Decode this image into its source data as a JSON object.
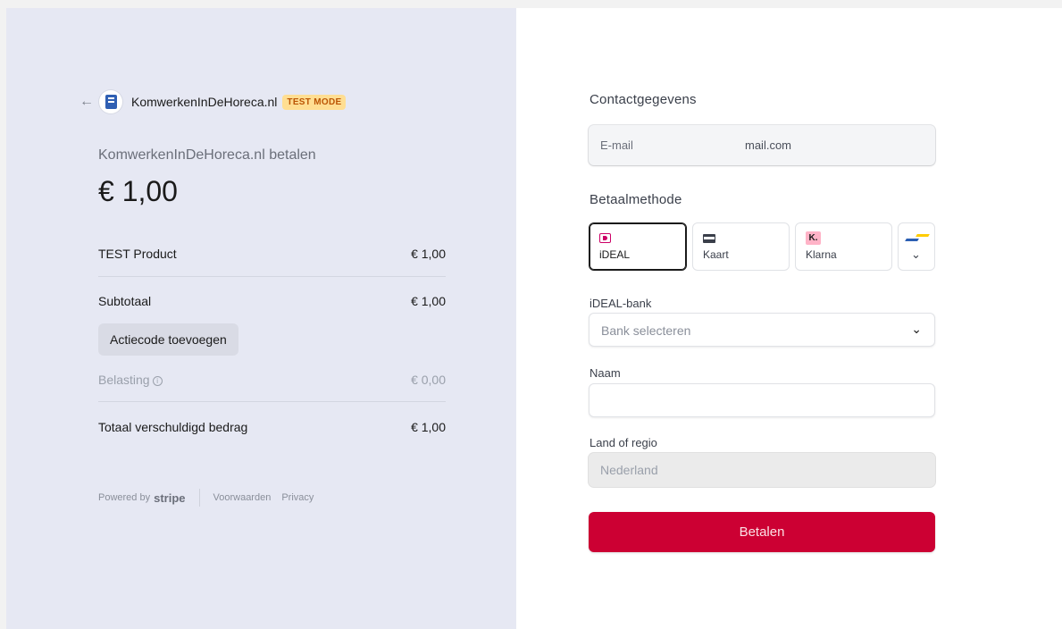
{
  "summary": {
    "back_icon": "arrow-left-icon",
    "merchant_name": "KomwerkenInDeHoreca.nl",
    "test_mode_badge": "TEST MODE",
    "pay_label": "KomwerkenInDeHoreca.nl betalen",
    "amount": "€ 1,00",
    "line_items": [
      {
        "name": "TEST Product",
        "price": "€ 1,00"
      }
    ],
    "subtotal_label": "Subtotaal",
    "subtotal_value": "€ 1,00",
    "promo_button": "Actiecode toevoegen",
    "tax_label": "Belasting",
    "tax_icon": "info-icon",
    "tax_value": "€ 0,00",
    "total_label": "Totaal verschuldigd bedrag",
    "total_value": "€ 1,00"
  },
  "footer": {
    "powered_by": "Powered by",
    "brand": "stripe",
    "terms": "Voorwaarden",
    "privacy": "Privacy"
  },
  "form": {
    "contact_title": "Contactgegevens",
    "email_label": "E-mail",
    "email_value": "mail.com",
    "payment_title": "Betaalmethode",
    "methods": [
      {
        "label": "iDEAL",
        "icon": "ideal-icon",
        "selected": true
      },
      {
        "label": "Kaart",
        "icon": "card-icon",
        "selected": false
      },
      {
        "label": "Klarna",
        "icon": "klarna-icon",
        "icon_text": "K.",
        "selected": false
      }
    ],
    "more_methods_icon": "chevron-down-icon",
    "bank_label": "iDEAL-bank",
    "bank_placeholder": "Bank selecteren",
    "name_label": "Naam",
    "name_value": "",
    "country_label": "Land of regio",
    "country_value": "Nederland",
    "pay_button": "Betalen"
  },
  "colors": {
    "accent": "#cc0033",
    "left_background": "#e6e8f3",
    "test_badge_bg": "#ffde92",
    "test_badge_text": "#bb5504"
  }
}
